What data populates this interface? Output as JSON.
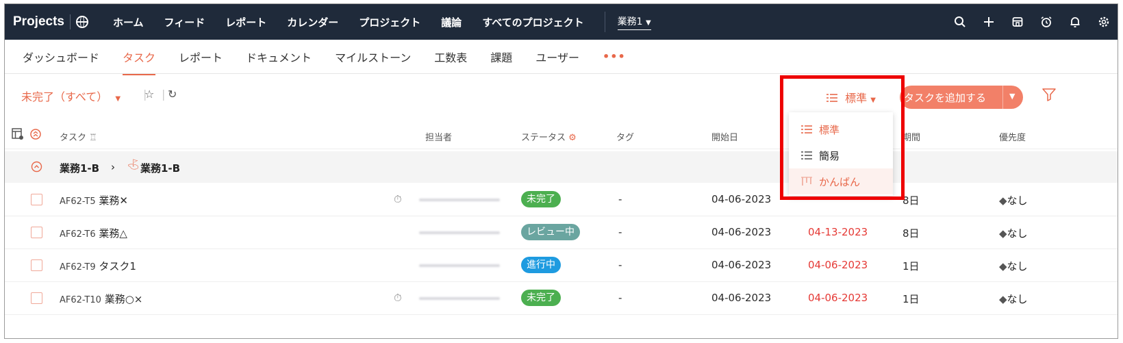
{
  "app": {
    "title": "Projects"
  },
  "topnav": {
    "items": [
      "ホーム",
      "フィード",
      "レポート",
      "カレンダー",
      "プロジェクト",
      "議論",
      "すべてのプロジェクト"
    ],
    "project_selector": "業務1"
  },
  "subnav": {
    "items": [
      "ダッシュボード",
      "タスク",
      "レポート",
      "ドキュメント",
      "マイルストーン",
      "工数表",
      "課題",
      "ユーザー"
    ],
    "active": "タスク",
    "more": "•••"
  },
  "toolbar": {
    "filter_label": "未完了（すべて）",
    "view_label": "標準",
    "add_task_label": "タスクを追加する"
  },
  "columns": [
    "タスク",
    "担当者",
    "ステータス",
    "タグ",
    "開始日",
    "期間",
    "優先度"
  ],
  "group": {
    "parent": "業務1-B",
    "child": "業務1-B"
  },
  "tasks": [
    {
      "id": "AF62-T5",
      "name": "業務✕",
      "status": "未完了",
      "status_color": "#4caf50",
      "tag": "-",
      "start": "04-06-2023",
      "end": "",
      "duration": "8日",
      "priority": "なし"
    },
    {
      "id": "AF62-T6",
      "name": "業務△",
      "status": "レビュー中",
      "status_color": "#6aa5a0",
      "tag": "-",
      "start": "04-06-2023",
      "end": "04-13-2023",
      "duration": "8日",
      "priority": "なし"
    },
    {
      "id": "AF62-T9",
      "name": "タスク1",
      "status": "進行中",
      "status_color": "#1e9be0",
      "tag": "-",
      "start": "04-06-2023",
      "end": "04-06-2023",
      "duration": "1日",
      "priority": "なし"
    },
    {
      "id": "AF62-T10",
      "name": "業務○×",
      "status": "未完了",
      "status_color": "#4caf50",
      "tag": "-",
      "start": "04-06-2023",
      "end": "04-06-2023",
      "duration": "1日",
      "priority": "なし"
    }
  ],
  "view_dropdown": {
    "items": [
      "標準",
      "簡易",
      "かんばん"
    ]
  },
  "colors": {
    "accent": "#e8684a",
    "topbar": "#1f2a3a",
    "highlight": "#ee0000"
  }
}
